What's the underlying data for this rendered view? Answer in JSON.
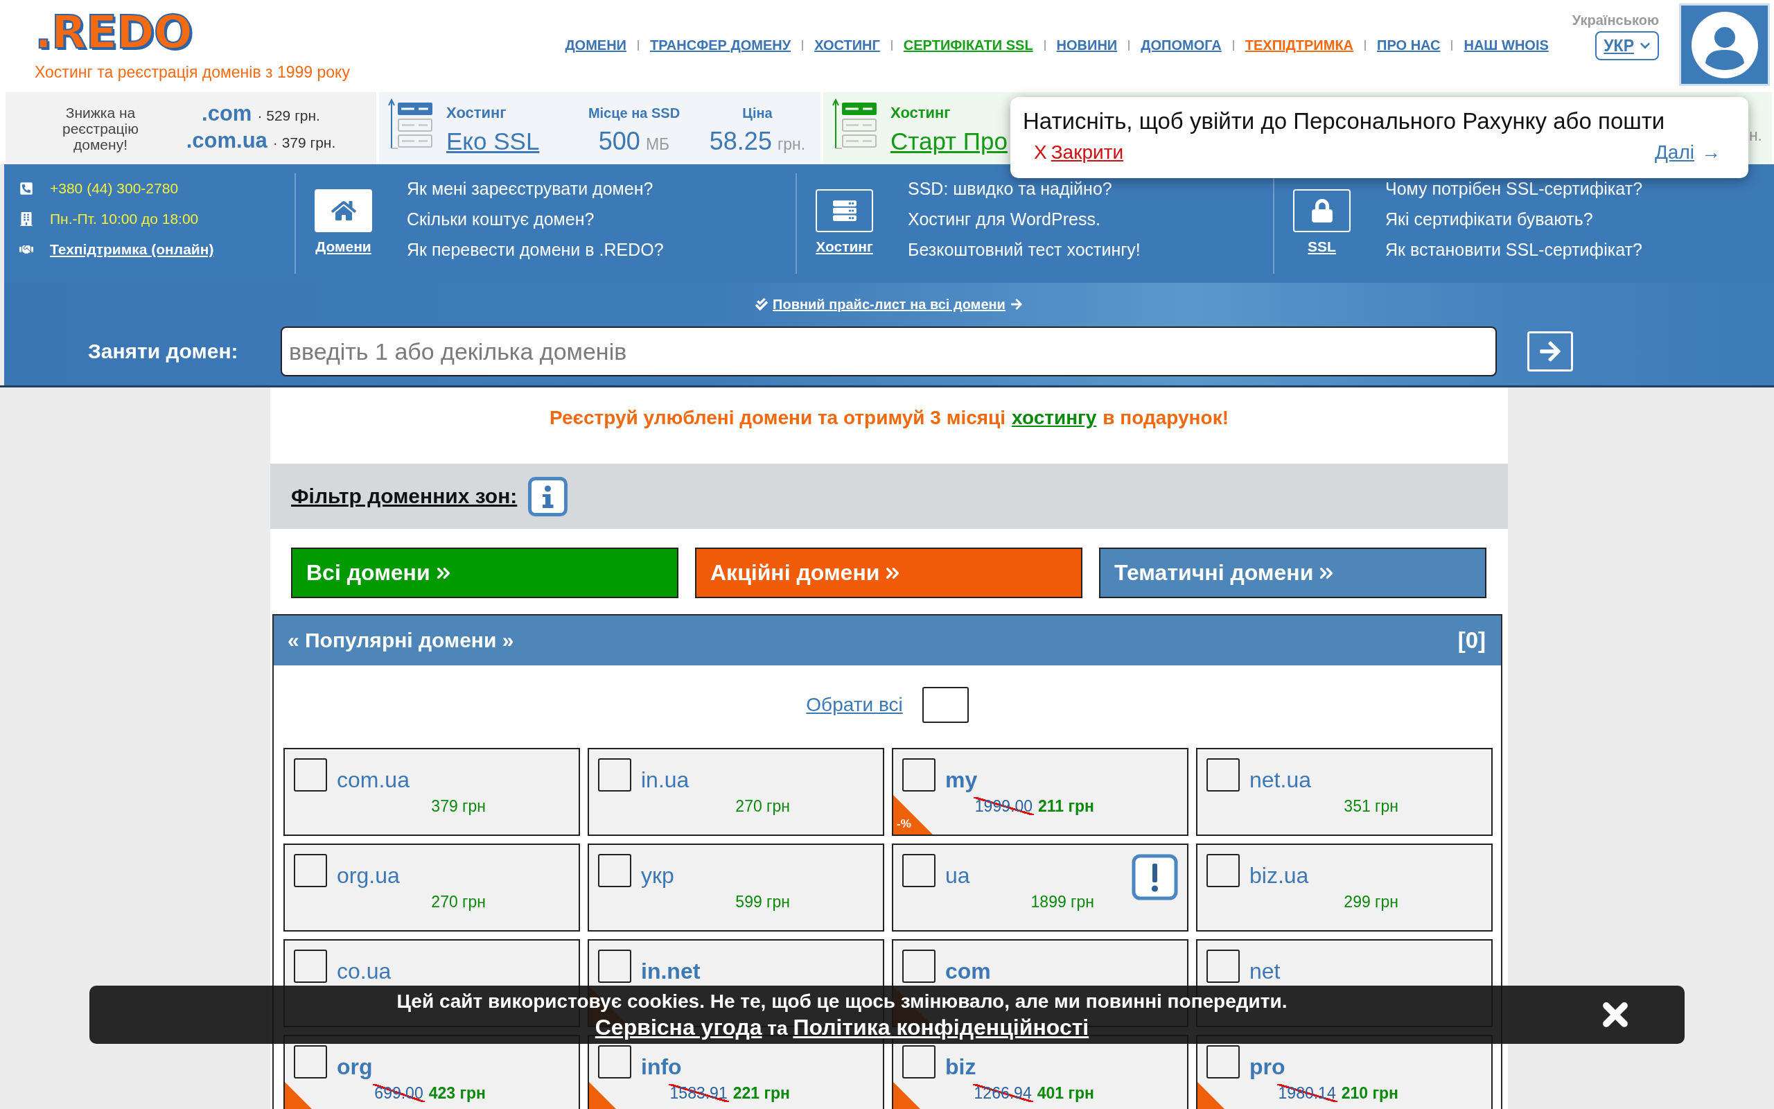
{
  "header": {
    "logo": ".REDO",
    "tagline": "Хостинг та реєстрація доменів з 1999 року",
    "nav": [
      {
        "label": "ДОМЕНИ",
        "color": "#3a74b4"
      },
      {
        "label": "ТРАНСФЕР ДОМЕНУ",
        "color": "#3a74b4"
      },
      {
        "label": "ХОСТИНГ",
        "color": "#3a74b4"
      },
      {
        "label": "СЕРТИФІКАТИ SSL",
        "color": "#16a016"
      },
      {
        "label": "НОВИНИ",
        "color": "#3a74b4"
      },
      {
        "label": "ДОПОМОГА",
        "color": "#3a74b4"
      },
      {
        "label": "ТЕХПІДТРИМКА",
        "color": "#f2680f"
      },
      {
        "label": "ПРО НАС",
        "color": "#3a74b4"
      },
      {
        "label": "НАШ WHOIS",
        "color": "#3a74b4"
      }
    ],
    "language": {
      "caption": "Українською",
      "current": "УКР"
    }
  },
  "offers_bar": {
    "discount": {
      "caption": "Знижка на реєстрацію домену!",
      "offers": [
        {
          "zone": ".com",
          "price": "· 529 грн."
        },
        {
          "zone": ".com.ua",
          "price": "· 379 грн."
        }
      ]
    },
    "plans": [
      {
        "label": "Хостинг",
        "name": "Еко SSL",
        "color": "#3d78b6",
        "specs": [
          {
            "label": "Місце на SSD",
            "value": "500",
            "unit": "МБ"
          },
          {
            "label": "Ціна",
            "value": "58.25",
            "unit": "грн."
          }
        ]
      },
      {
        "label": "Хостинг",
        "name": "Старт Про",
        "color": "#149a14",
        "specs": [
          {
            "unit": "н."
          }
        ]
      }
    ]
  },
  "login_popup": {
    "message": "Натисніть, щоб увійти до Персонального Рахунку або пошти",
    "close_mark": "Х",
    "close_label": "Закрити",
    "next_label": "Далі",
    "next_arrow": "→"
  },
  "help": {
    "contacts": [
      {
        "kind": "phone",
        "text": "+380 (44) 300-2780"
      },
      {
        "kind": "hours",
        "text": "Пн.-Пт. 10:00 до 18:00"
      },
      {
        "kind": "support",
        "text": "Техпідтримка (онлайн)"
      }
    ],
    "sections": [
      {
        "kind": "domains",
        "label": "Домени",
        "links": [
          "Як мені зареєструвати домен?",
          "Скільки коштує домен?",
          "Як перевести домени в .REDO?"
        ]
      },
      {
        "kind": "hosting",
        "label": "Хостинг",
        "links": [
          "SSD: швидко та надійно?",
          "Хостинг для WordPress.",
          "Безкоштовний тест хостингу!"
        ]
      },
      {
        "kind": "ssl",
        "label": "SSL",
        "links": [
          "Чому потрібен SSL-сертифікат?",
          "Які сертифікати бувають?",
          "Як встановити SSL-сертифікат?"
        ]
      }
    ]
  },
  "price_list_link": "Повний прайс-лист на всі домени",
  "domain_search": {
    "label": "Заняти домен:",
    "placeholder": "введіть 1 або декілька доменів"
  },
  "promo": {
    "before": "Реєструй улюблені домени та отримуй 3 місяці",
    "link": "хостингу",
    "after": "в подарунок!"
  },
  "filter": {
    "label": "Фільтр доменних зон:",
    "categories": [
      {
        "label": "Всі домени",
        "color": "#009a00"
      },
      {
        "label": "Акційні домени",
        "color": "#f05c0a"
      },
      {
        "label": "Тематичні домени",
        "color": "#4f86ba"
      }
    ]
  },
  "popular": {
    "title": "« Популярні домени »",
    "count": "[0]",
    "select_all": {
      "label": "Обрати всі",
      "checked": false
    },
    "domains": [
      {
        "zone": "com.ua",
        "price": "379 грн",
        "sale": false,
        "notice": false,
        "checked": false
      },
      {
        "zone": "in.ua",
        "price": "270 грн",
        "sale": false,
        "notice": false,
        "checked": false
      },
      {
        "zone": "my",
        "old_price": "1999.00",
        "price": "211 грн",
        "badge": "-%",
        "sale": true,
        "notice": false,
        "checked": false
      },
      {
        "zone": "net.ua",
        "price": "351 грн",
        "sale": false,
        "notice": false,
        "checked": false
      },
      {
        "zone": "org.ua",
        "price": "270 грн",
        "sale": false,
        "notice": false,
        "checked": false
      },
      {
        "zone": "укр",
        "price": "599 грн",
        "sale": false,
        "notice": false,
        "checked": false
      },
      {
        "zone": "ua",
        "price": "1899 грн",
        "sale": false,
        "notice": true,
        "checked": false
      },
      {
        "zone": "biz.ua",
        "price": "299 грн",
        "sale": false,
        "notice": false,
        "checked": false
      },
      {
        "zone": "co.ua",
        "sale": false,
        "notice": false,
        "checked": false
      },
      {
        "zone": "in.net",
        "sale": true,
        "notice": false,
        "checked": false
      },
      {
        "zone": "com",
        "sale": true,
        "notice": false,
        "checked": false
      },
      {
        "zone": "net",
        "sale": false,
        "notice": false,
        "checked": false
      },
      {
        "zone": "org",
        "old_price": "699.00",
        "price": "423 грн",
        "sale": true,
        "notice": false,
        "checked": false
      },
      {
        "zone": "info",
        "old_price": "1583.91",
        "price": "221 грн",
        "sale": true,
        "notice": false,
        "checked": false
      },
      {
        "zone": "biz",
        "old_price": "1266.94",
        "price": "401 грн",
        "sale": true,
        "notice": false,
        "checked": false
      },
      {
        "zone": "pro",
        "old_price": "1980.14",
        "price": "210 грн",
        "sale": true,
        "notice": false,
        "checked": false
      }
    ]
  },
  "cookie_notice": {
    "message": "Цей сайт використовує cookies. Не те, щоб це щось змінювало, але ми повинні попередити.",
    "links": [
      "Сервісна угода",
      "Політика конфіденційності"
    ],
    "joiner": "та"
  }
}
